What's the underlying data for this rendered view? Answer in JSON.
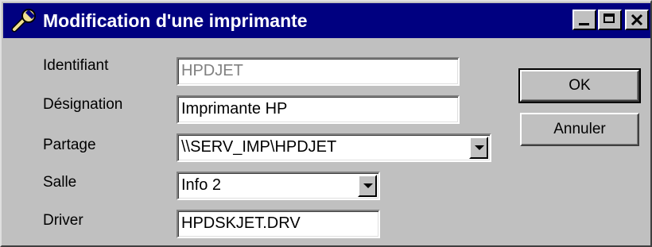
{
  "window": {
    "title": "Modification d'une imprimante",
    "icon": "wrench-icon",
    "controls": [
      "minimize",
      "maximize",
      "close"
    ]
  },
  "form": {
    "identifiant": {
      "label": "Identifiant",
      "value": "HPDJET"
    },
    "designation": {
      "label": "Désignation",
      "value": "Imprimante HP"
    },
    "partage": {
      "label": "Partage",
      "value": "\\\\SERV_IMP\\HPDJET"
    },
    "salle": {
      "label": "Salle",
      "value": "Info 2"
    },
    "driver": {
      "label": "Driver",
      "value": "HPDSKJET.DRV"
    }
  },
  "buttons": {
    "ok": "OK",
    "cancel": "Annuler"
  },
  "colors": {
    "titlebar": "#000080",
    "face": "#c0c0c0",
    "disabled_text": "#808080"
  }
}
